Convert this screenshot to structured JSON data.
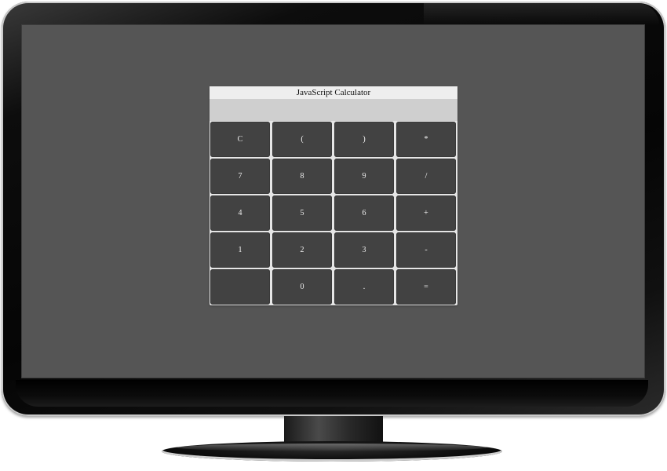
{
  "calculator": {
    "title": "JavaScript Calculator",
    "display": "",
    "keys": [
      {
        "label": "C",
        "name": "clear-button"
      },
      {
        "label": "(",
        "name": "open-paren-button"
      },
      {
        "label": ")",
        "name": "close-paren-button"
      },
      {
        "label": "*",
        "name": "multiply-button"
      },
      {
        "label": "7",
        "name": "digit-7-button"
      },
      {
        "label": "8",
        "name": "digit-8-button"
      },
      {
        "label": "9",
        "name": "digit-9-button"
      },
      {
        "label": "/",
        "name": "divide-button"
      },
      {
        "label": "4",
        "name": "digit-4-button"
      },
      {
        "label": "5",
        "name": "digit-5-button"
      },
      {
        "label": "6",
        "name": "digit-6-button"
      },
      {
        "label": "+",
        "name": "add-button"
      },
      {
        "label": "1",
        "name": "digit-1-button"
      },
      {
        "label": "2",
        "name": "digit-2-button"
      },
      {
        "label": "3",
        "name": "digit-3-button"
      },
      {
        "label": "-",
        "name": "subtract-button"
      },
      {
        "label": "",
        "name": "blank-button"
      },
      {
        "label": "0",
        "name": "digit-0-button"
      },
      {
        "label": ".",
        "name": "decimal-button"
      },
      {
        "label": "=",
        "name": "equals-button"
      }
    ]
  },
  "colors": {
    "screen_background": "#555555",
    "key_background": "#424242",
    "key_text": "#f2f2f2",
    "display_background": "#cfcfcf",
    "window_background": "#e6e6e6"
  }
}
